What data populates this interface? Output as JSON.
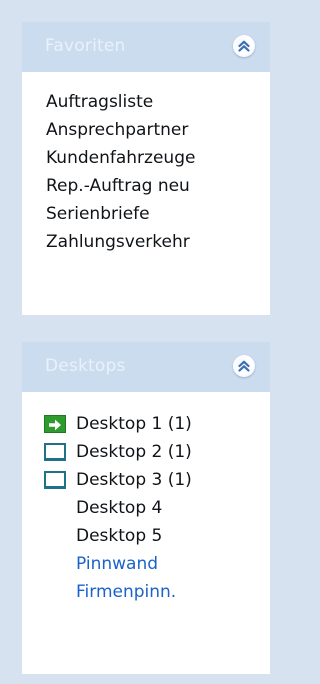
{
  "favorites": {
    "title": "Favoriten",
    "items": [
      {
        "label": "Auftragsliste"
      },
      {
        "label": "Ansprechpartner"
      },
      {
        "label": "Kundenfahrzeuge"
      },
      {
        "label": "Rep.-Auftrag neu"
      },
      {
        "label": "Serienbriefe"
      },
      {
        "label": "Zahlungsverkehr"
      }
    ]
  },
  "desktops": {
    "title": "Desktops",
    "items": [
      {
        "label": "Desktop 1 (1)",
        "icon": "green-arrow-icon"
      },
      {
        "label": "Desktop 2 (1)",
        "icon": "monitor-icon"
      },
      {
        "label": "Desktop 3 (1)",
        "icon": "monitor-icon"
      },
      {
        "label": "Desktop 4",
        "icon": ""
      },
      {
        "label": "Desktop 5",
        "icon": ""
      },
      {
        "label": "Pinnwand",
        "icon": "",
        "link": true
      },
      {
        "label": "Firmenpinn.",
        "icon": "",
        "link": true
      }
    ]
  },
  "colors": {
    "background": "#d6e2f0",
    "header": "#ccdcef",
    "link": "#1a62c9",
    "arrow_green": "#2f9b2f",
    "monitor_teal": "#20708a"
  }
}
